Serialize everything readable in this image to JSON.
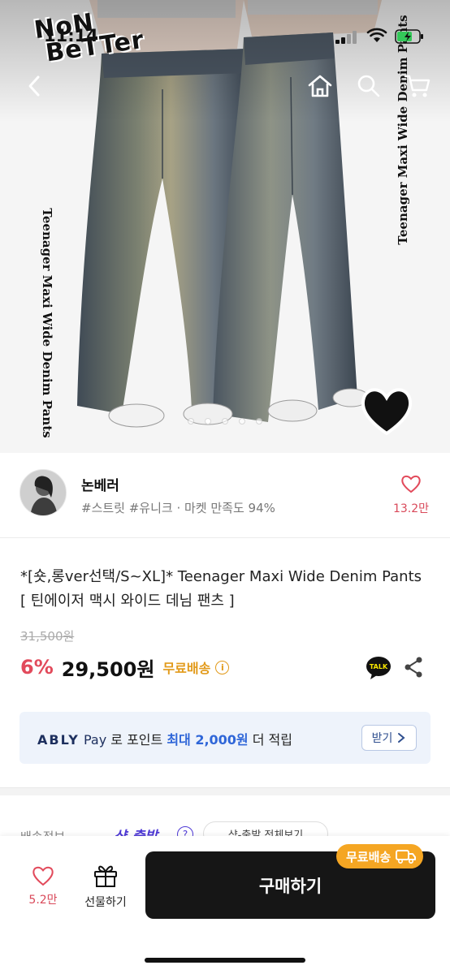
{
  "status_bar": {
    "time": "11:14"
  },
  "hero": {
    "logo_line1": "NoN",
    "logo_line2": "BeTTer",
    "side_text": "Teenager Maxi Wide Denim Pants",
    "carousel": {
      "count": 5,
      "active_index": 1
    }
  },
  "nav": {
    "back_icon": "back-icon",
    "home_icon": "home-icon",
    "search_icon": "search-icon",
    "cart_icon": "cart-icon"
  },
  "seller": {
    "name": "논베러",
    "tags": "#스트릿 #유니크 · 마켓 만족도 94%",
    "like_count": "13.2만"
  },
  "product": {
    "title": "*[숏,롱ver선택/S~XL]* Teenager Maxi Wide Denim Pants [ 틴에이저 맥시 와이드 데님 팬츠 ]",
    "original_price": "31,500원",
    "discount": "6%",
    "price": "29,500원",
    "shipping": "무료배송",
    "info_icon": "i",
    "talk_label": "TALK"
  },
  "pay_banner": {
    "brand": "ABLY",
    "pay": "Pay",
    "text_pre": " 로 포인트 ",
    "highlight": "최대 2,000원",
    "text_post": " 더 적립",
    "button": "받기"
  },
  "shipping_info": {
    "label": "배송정보",
    "fast": "샥-출발",
    "q": "?",
    "pill": "샥-출발 전체보기"
  },
  "bottom_bar": {
    "like_count": "5.2만",
    "gift_label": "선물하기",
    "buy_label": "구매하기",
    "badge": "무료배송"
  },
  "colors": {
    "accent_red": "#e24a5b",
    "shipping_orange": "#f5a623",
    "buy_button": "#161616",
    "pay_banner_bg": "#eef3fb",
    "pay_highlight": "#2f66d8"
  }
}
